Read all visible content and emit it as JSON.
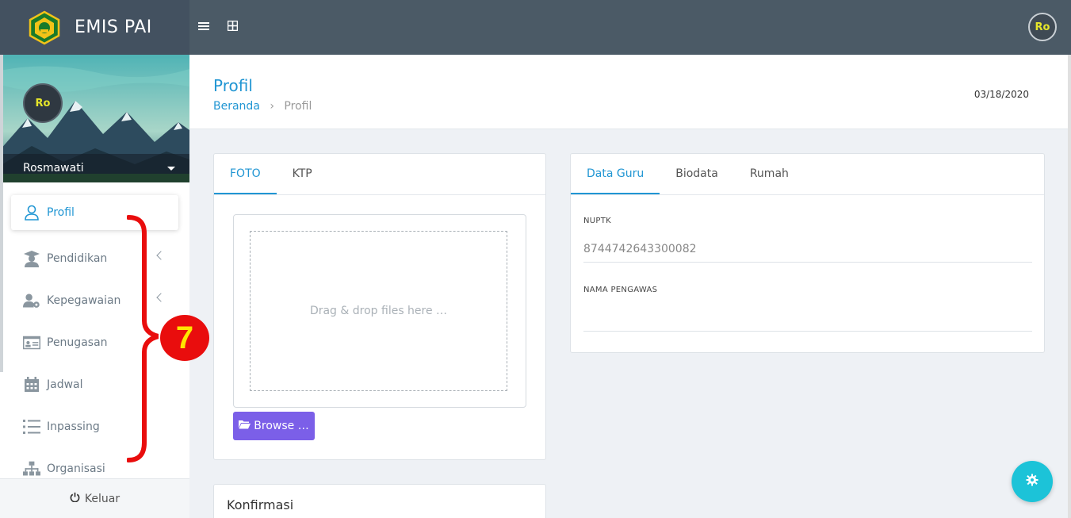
{
  "app": {
    "name": "EMIS PAI"
  },
  "topbar": {
    "menu_icon": "hamburger-icon",
    "grid_icon": "grid-icon",
    "avatar_initials": "Ro"
  },
  "sidebar": {
    "avatar_initials": "Ro",
    "user_name": "Rosmawati",
    "items": [
      {
        "label": "Profil",
        "icon": "user-icon",
        "active": true,
        "has_submenu": false
      },
      {
        "label": "Pendidikan",
        "icon": "graduate-icon",
        "active": false,
        "has_submenu": true
      },
      {
        "label": "Kepegawaian",
        "icon": "user-gear-icon",
        "active": false,
        "has_submenu": true
      },
      {
        "label": "Penugasan",
        "icon": "id-card-icon",
        "active": false,
        "has_submenu": false
      },
      {
        "label": "Jadwal",
        "icon": "calendar-icon",
        "active": false,
        "has_submenu": false
      },
      {
        "label": "Inpassing",
        "icon": "list-icon",
        "active": false,
        "has_submenu": false
      },
      {
        "label": "Organisasi",
        "icon": "sitemap-icon",
        "active": false,
        "has_submenu": false
      }
    ],
    "logout_label": "Keluar"
  },
  "annotation": {
    "number": "7"
  },
  "page": {
    "title": "Profil",
    "breadcrumb": {
      "home": "Beranda",
      "current": "Profil"
    },
    "date": "03/18/2020"
  },
  "photo_card": {
    "tabs": [
      "FOTO",
      "KTP"
    ],
    "active_tab": "FOTO",
    "dropzone_text": "Drag & drop files here …",
    "browse_label": "Browse …"
  },
  "data_card": {
    "tabs": [
      "Data Guru",
      "Biodata",
      "Rumah"
    ],
    "active_tab": "Data Guru",
    "fields": [
      {
        "label": "NUPTK",
        "value": "8744742643300082"
      },
      {
        "label": "NAMA PENGAWAS",
        "value": ""
      }
    ]
  },
  "confirm_card": {
    "title": "Konfirmasi"
  },
  "colors": {
    "primary": "#2196d3",
    "topbar": "#4b5a66",
    "browse": "#7b5fe8",
    "fab": "#1cc3d8",
    "annotation": "#e90d0d"
  }
}
